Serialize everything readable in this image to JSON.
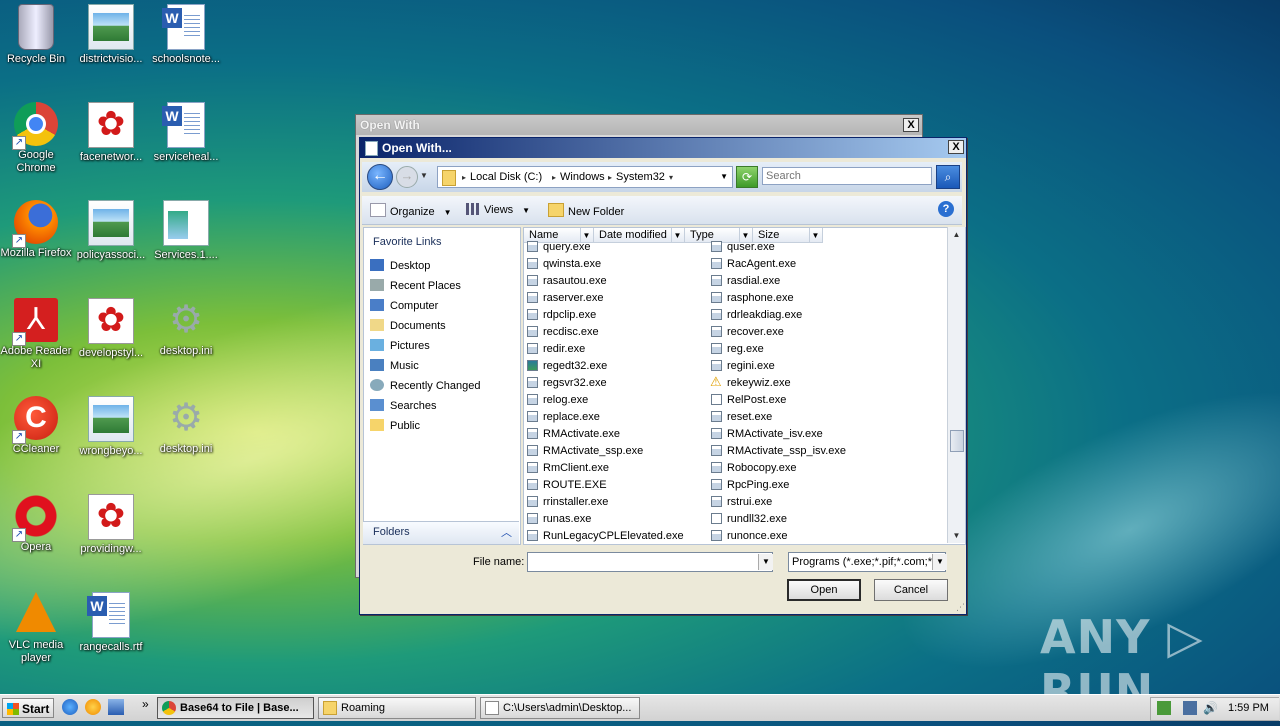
{
  "desktop": {
    "icons": [
      {
        "label": "Recycle Bin"
      },
      {
        "label": "districtvisio..."
      },
      {
        "label": "schoolsnote..."
      },
      {
        "label": "Google Chrome"
      },
      {
        "label": "facenetwor..."
      },
      {
        "label": "serviceheal..."
      },
      {
        "label": "Mozilla Firefox"
      },
      {
        "label": "policyassoci..."
      },
      {
        "label": "Services.1...."
      },
      {
        "label": "Adobe Reader XI"
      },
      {
        "label": "developstyl..."
      },
      {
        "label": "desktop.ini"
      },
      {
        "label": "CCleaner"
      },
      {
        "label": "wrongbeyo..."
      },
      {
        "label": "desktop.ini"
      },
      {
        "label": "Opera"
      },
      {
        "label": "providingw..."
      },
      {
        "label": "VLC media player"
      },
      {
        "label": "rangecalls.rtf"
      }
    ]
  },
  "bg_window": {
    "title": "Open With",
    "close": "X"
  },
  "dialog": {
    "title": "Open With...",
    "close": "X",
    "breadcrumb": [
      "Local Disk (C:)",
      "Windows",
      "System32"
    ],
    "search_placeholder": "Search",
    "toolbar": {
      "organize": "Organize",
      "views": "Views",
      "new_folder": "New Folder"
    },
    "favorites_title": "Favorite Links",
    "favorites": [
      "Desktop",
      "Recent Places",
      "Computer",
      "Documents",
      "Pictures",
      "Music",
      "Recently Changed",
      "Searches",
      "Public"
    ],
    "folders_label": "Folders",
    "columns": [
      "Name",
      "Date modified",
      "Type",
      "Size"
    ],
    "files_left": [
      "query.exe",
      "qwinsta.exe",
      "rasautou.exe",
      "raserver.exe",
      "rdpclip.exe",
      "recdisc.exe",
      "redir.exe",
      "regedt32.exe",
      "regsvr32.exe",
      "relog.exe",
      "replace.exe",
      "RMActivate.exe",
      "RMActivate_ssp.exe",
      "RmClient.exe",
      "ROUTE.EXE",
      "rrinstaller.exe",
      "runas.exe",
      "RunLegacyCPLElevated.exe"
    ],
    "files_right": [
      "quser.exe",
      "RacAgent.exe",
      "rasdial.exe",
      "rasphone.exe",
      "rdrleakdiag.exe",
      "recover.exe",
      "reg.exe",
      "regini.exe",
      "rekeywiz.exe",
      "RelPost.exe",
      "reset.exe",
      "RMActivate_isv.exe",
      "RMActivate_ssp_isv.exe",
      "Robocopy.exe",
      "RpcPing.exe",
      "rstrui.exe",
      "rundll32.exe",
      "runonce.exe"
    ],
    "file_name_label": "File name:",
    "file_name_value": "",
    "filter": "Programs (*.exe;*.pif;*.com;*.bat;*.cmd)",
    "open_label": "Open",
    "cancel_label": "Cancel"
  },
  "taskbar": {
    "start": "Start",
    "tasks": [
      {
        "label": "Base64 to File | Base..."
      },
      {
        "label": "Roaming"
      },
      {
        "label": "C:\\Users\\admin\\Desktop..."
      }
    ],
    "clock": "1:59 PM"
  },
  "watermark": "ANY ▷ RUN"
}
